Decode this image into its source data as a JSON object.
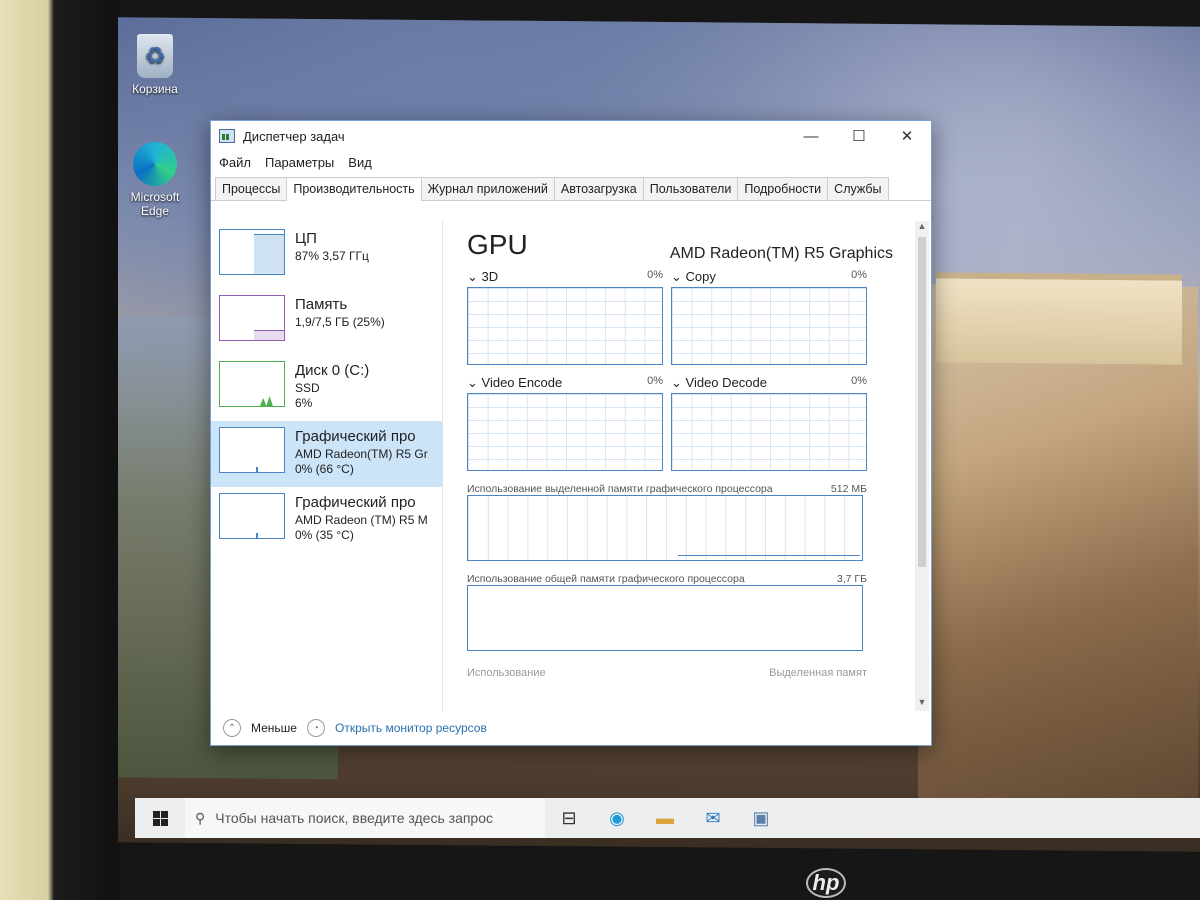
{
  "desktop": {
    "icons": [
      {
        "label": "Корзина"
      },
      {
        "label": "Microsoft Edge"
      }
    ]
  },
  "window": {
    "title": "Диспетчер задач",
    "controls": {
      "minimize": "—",
      "maximize": "☐",
      "close": "✕"
    },
    "menu": [
      "Файл",
      "Параметры",
      "Вид"
    ],
    "tabs": [
      "Процессы",
      "Производительность",
      "Журнал приложений",
      "Автозагрузка",
      "Пользователи",
      "Подробности",
      "Службы"
    ],
    "active_tab": "Производительность"
  },
  "resources": [
    {
      "name": "ЦП",
      "line1": "87% 3,57 ГГц",
      "line2": ""
    },
    {
      "name": "Память",
      "line1": "1,9/7,5 ГБ (25%)",
      "line2": ""
    },
    {
      "name": "Диск 0 (C:)",
      "line1": "SSD",
      "line2": "6%"
    },
    {
      "name": "Графический про",
      "line1": "AMD Radeon(TM) R5 Gr",
      "line2": "0% (66 °C)"
    },
    {
      "name": "Графический про",
      "line1": "AMD Radeon (TM) R5 M",
      "line2": "0% (35 °C)"
    }
  ],
  "gpu": {
    "title": "GPU",
    "model": "AMD Radeon(TM) R5 Graphics",
    "engines": [
      {
        "name": "3D",
        "percent": "0%"
      },
      {
        "name": "Copy",
        "percent": "0%"
      },
      {
        "name": "Video Encode",
        "percent": "0%"
      },
      {
        "name": "Video Decode",
        "percent": "0%"
      }
    ],
    "dedicated_label": "Использование выделенной памяти графического процессора",
    "dedicated_value": "512 МБ",
    "shared_label": "Использование общей памяти графического процессора",
    "shared_value": "3,7 ГБ",
    "bottom_left": "Использование",
    "bottom_right": "Выделенная памят"
  },
  "footer": {
    "fewer": "Меньше",
    "open_monitor": "Открыть монитор ресурсов"
  },
  "taskbar": {
    "search_placeholder": "Чтобы начать поиск, введите здесь запрос"
  },
  "brand": "hp"
}
